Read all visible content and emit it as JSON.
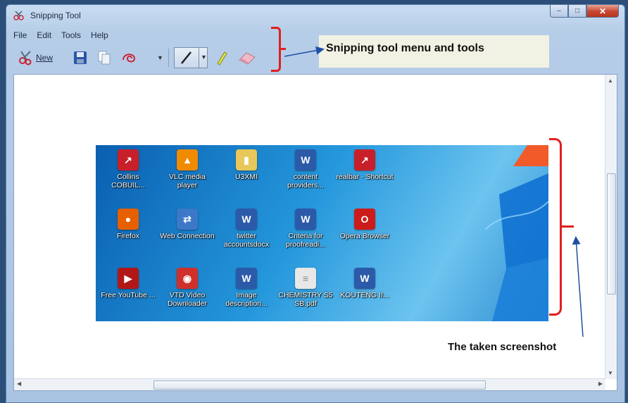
{
  "window": {
    "title": "Snipping Tool",
    "controls": {
      "minimize": "–",
      "maximize": "□",
      "close": "✕"
    }
  },
  "menu": {
    "items": [
      "File",
      "Edit",
      "Tools",
      "Help"
    ]
  },
  "toolbar": {
    "new_label": "New",
    "icons": [
      "new-snip-icon",
      "save-icon",
      "copy-icon",
      "send-snip-icon",
      "pen-icon",
      "highlighter-icon",
      "eraser-icon"
    ]
  },
  "annotations": {
    "top_callout": "Snipping tool menu and tools",
    "bottom_caption": "The taken screenshot",
    "bracket_color": "#e01f1f",
    "arrow_color": "#1f4fa3"
  },
  "desktop_icons": [
    {
      "label": "Collins COBUIL...",
      "icon": "red-app-shortcut-icon",
      "color": "#c8202a"
    },
    {
      "label": "VLC media player",
      "icon": "vlc-cone-icon",
      "color": "#f08a00"
    },
    {
      "label": "U3XMI",
      "icon": "folder-icon",
      "color": "#e8c85a"
    },
    {
      "label": "content providers...",
      "icon": "word-doc-icon",
      "color": "#2b5aa8"
    },
    {
      "label": "realbar - Shortcut",
      "icon": "red-app-shortcut-icon",
      "color": "#c8202a"
    },
    {
      "label": "Firefox",
      "icon": "firefox-icon",
      "color": "#e66000"
    },
    {
      "label": "Web Connection",
      "icon": "network-icon",
      "color": "#3c78c8"
    },
    {
      "label": "twitter accountsdocx",
      "icon": "word-doc-icon",
      "color": "#2b5aa8"
    },
    {
      "label": "Criteria for proofreadi...",
      "icon": "word-doc-icon",
      "color": "#2b5aa8"
    },
    {
      "label": "Opera Browser",
      "icon": "opera-icon",
      "color": "#cc1b1b"
    },
    {
      "label": "Free YouTube ...",
      "icon": "tv-icon",
      "color": "#b01818"
    },
    {
      "label": "VTD Video Downloader",
      "icon": "vtd-icon",
      "color": "#d0302a"
    },
    {
      "label": "Image description...",
      "icon": "word-doc-icon",
      "color": "#2b5aa8"
    },
    {
      "label": "CHEMISTRY S5 SB.pdf",
      "icon": "pdf-doc-icon",
      "color": "#e8e8e8"
    },
    {
      "label": "KOUTENG II...",
      "icon": "word-doc-icon",
      "color": "#2b5aa8"
    }
  ],
  "colors": {
    "snip_bg_dark": "#0a5fb0",
    "snip_bg_light": "#6cc4ef",
    "window_frame": "#b6cde8"
  }
}
